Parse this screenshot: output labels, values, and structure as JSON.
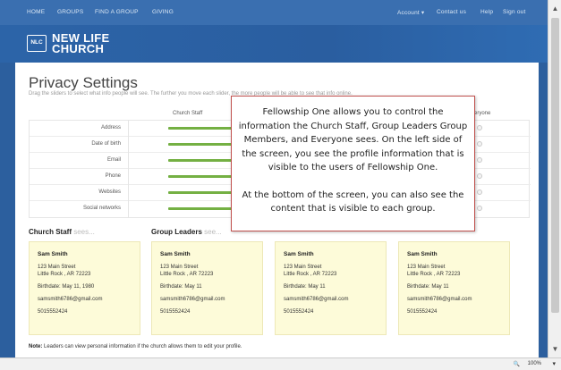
{
  "nav": {
    "left": [
      "HOME",
      "GROUPS",
      "FIND A GROUP",
      "GIVING"
    ],
    "right": [
      "Account",
      "Contact us",
      "Help",
      "Sign out"
    ]
  },
  "brand": {
    "logo_abbr": "NLC",
    "line1": "NEW LIFE",
    "line2": "CHURCH"
  },
  "page": {
    "title": "Privacy Settings",
    "subtitle": "Drag the sliders to select what info people will see. The further you move each slider, the more people will be able to see that info online.",
    "columns": [
      "Church Staff",
      "Everyone"
    ],
    "rows": [
      "Address",
      "Date of birth",
      "Email",
      "Phone",
      "Websites",
      "Social networks"
    ]
  },
  "groups": [
    {
      "label": "Church Staff",
      "sees": "sees..."
    },
    {
      "label": "Group Leaders",
      "sees": "see..."
    }
  ],
  "profile": {
    "name": "Sam Smith",
    "street": "123 Main Street",
    "city": "Little Rock , AR  72223",
    "birth_full": "Birthdate: May 11, 1980",
    "birth_short": "Birthdate: May 11",
    "email": "samsmith6786@gmail.com",
    "phone": "5015552424"
  },
  "note": {
    "label": "Note:",
    "text": " Leaders can view personal information if the church allows them to edit your profile."
  },
  "callout": {
    "para1": "Fellowship One allows you to control the information the Church Staff, Group Leaders Group Members, and Everyone sees.  On the left side of the screen, you see the profile information that is visible to the users of Fellowship One.",
    "para2": "At the bottom of the screen, you can also see the content that is visible to each group."
  },
  "status": {
    "zoom": "100%"
  },
  "colors": {
    "header_blue": "#3a6fb0",
    "slider_green": "#74b043",
    "card_yellow": "#fdfbd9",
    "callout_border": "#c0504d"
  }
}
